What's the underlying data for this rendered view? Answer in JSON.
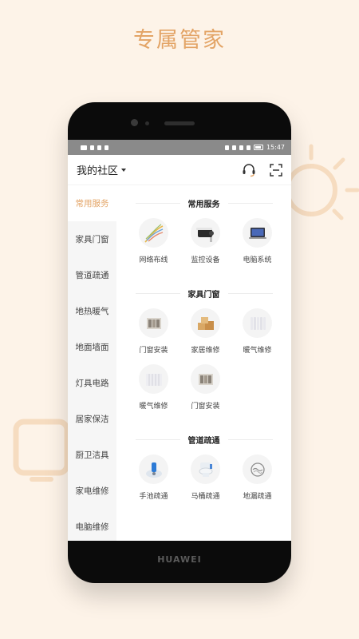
{
  "headline": "专属管家",
  "status_bar": {
    "time": "15:47"
  },
  "app": {
    "community_label": "我的社区",
    "icons": {
      "support": "headset-icon",
      "scan": "scan-icon"
    }
  },
  "sidebar": {
    "items": [
      {
        "label": "常用服务"
      },
      {
        "label": "家具门窗"
      },
      {
        "label": "管道疏通"
      },
      {
        "label": "地热暖气"
      },
      {
        "label": "地面墙面"
      },
      {
        "label": "灯具电路"
      },
      {
        "label": "居家保洁"
      },
      {
        "label": "厨卫洁具"
      },
      {
        "label": "家电维修"
      },
      {
        "label": "电脑维修"
      }
    ]
  },
  "sections": [
    {
      "title": "常用服务",
      "items": [
        {
          "label": "网络布线"
        },
        {
          "label": "监控设备"
        },
        {
          "label": "电脑系统"
        }
      ]
    },
    {
      "title": "家具门窗",
      "items": [
        {
          "label": "门窗安装"
        },
        {
          "label": "家居维修"
        },
        {
          "label": "暖气维修"
        },
        {
          "label": "暖气维修"
        },
        {
          "label": "门窗安装"
        }
      ]
    },
    {
      "title": "管道疏通",
      "items": [
        {
          "label": "手池疏通"
        },
        {
          "label": "马桶疏通"
        },
        {
          "label": "地漏疏通"
        }
      ]
    }
  ],
  "device_brand": "HUAWEI",
  "colors": {
    "accent": "#e3a466",
    "page_bg": "#fdf3e8"
  }
}
